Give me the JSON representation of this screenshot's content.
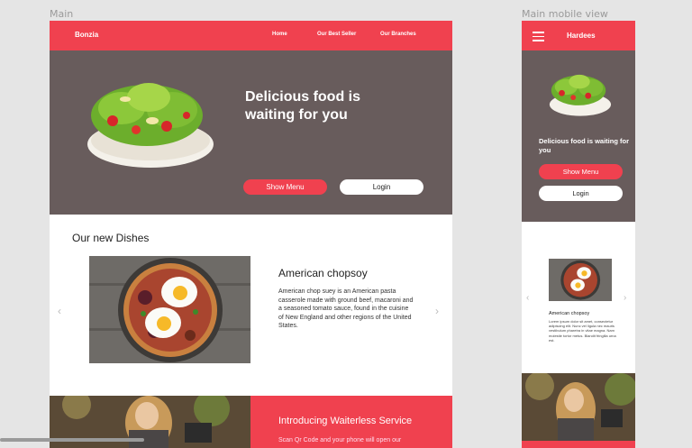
{
  "canvas": {
    "desktop_label": "Main",
    "mobile_label": "Main mobile view"
  },
  "desktop": {
    "brand": "Bonzia",
    "nav": [
      "Home",
      "Our Best Seller",
      "Our Branches"
    ],
    "hero": {
      "title": "Delicious food is waiting for you",
      "show_menu_label": "Show Menu",
      "login_label": "Login"
    },
    "dishes": {
      "section_title": "Our new Dishes",
      "dish_title": "American chopsoy",
      "dish_description": "American chop suey is an American pasta casserole made with ground beef, macaroni and a seasoned tomato sauce, found in the cuisine of New England and other regions of the United States."
    },
    "promo": {
      "title": "Introducing Waiterless Service",
      "text": "Scan Qr Code and your phone will open our"
    }
  },
  "mobile": {
    "brand": "Hardees",
    "hero": {
      "title": "Delicious food is waiting for you",
      "show_menu_label": "Show Menu",
      "login_label": "Login"
    },
    "dish_title": "American chopsoy",
    "dish_description": "Lorem ipsum dolor sit amet, consectetur adipiscing elit. Nunc vel ligula nec mauris vestibulum pharetra in vitae magna. Nam molestie tortor metus. Blandit fringilla urna est."
  },
  "colors": {
    "accent": "#f0414f",
    "hero_bg": "#685c5c",
    "canvas_bg": "#e5e5e5"
  },
  "icons": [
    "hamburger-menu-icon",
    "chevron-left-icon",
    "chevron-right-icon"
  ]
}
